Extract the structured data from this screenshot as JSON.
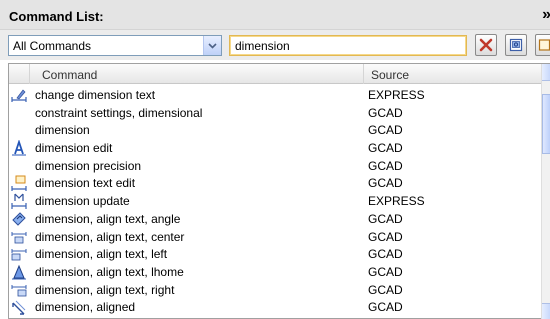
{
  "panel": {
    "title": "Command List:",
    "collapse_glyph": "»"
  },
  "toolbar": {
    "filter_value": "All Commands",
    "search_value": "dimension"
  },
  "table": {
    "columns": [
      "Command",
      "Source"
    ],
    "rows": [
      {
        "command": "change dimension text",
        "source": "EXPRESS",
        "icon": "change-dimension-text-icon"
      },
      {
        "command": "constraint settings, dimensional",
        "source": "GCAD",
        "icon": ""
      },
      {
        "command": "dimension",
        "source": "GCAD",
        "icon": ""
      },
      {
        "command": "dimension edit",
        "source": "GCAD",
        "icon": "dimension-edit-icon"
      },
      {
        "command": "dimension precision",
        "source": "GCAD",
        "icon": ""
      },
      {
        "command": "dimension text edit",
        "source": "GCAD",
        "icon": "dimension-text-edit-icon"
      },
      {
        "command": "dimension update",
        "source": "EXPRESS",
        "icon": "dimension-update-icon"
      },
      {
        "command": "dimension, align text, angle",
        "source": "GCAD",
        "icon": "align-text-angle-icon"
      },
      {
        "command": "dimension, align text, center",
        "source": "GCAD",
        "icon": "align-text-center-icon"
      },
      {
        "command": "dimension, align text, left",
        "source": "GCAD",
        "icon": "align-text-left-icon"
      },
      {
        "command": "dimension, align text, lhome",
        "source": "GCAD",
        "icon": "align-text-home-icon"
      },
      {
        "command": "dimension, align text, right",
        "source": "GCAD",
        "icon": "align-text-right-icon"
      },
      {
        "command": "dimension, aligned",
        "source": "GCAD",
        "icon": "dimension-aligned-icon"
      }
    ]
  }
}
